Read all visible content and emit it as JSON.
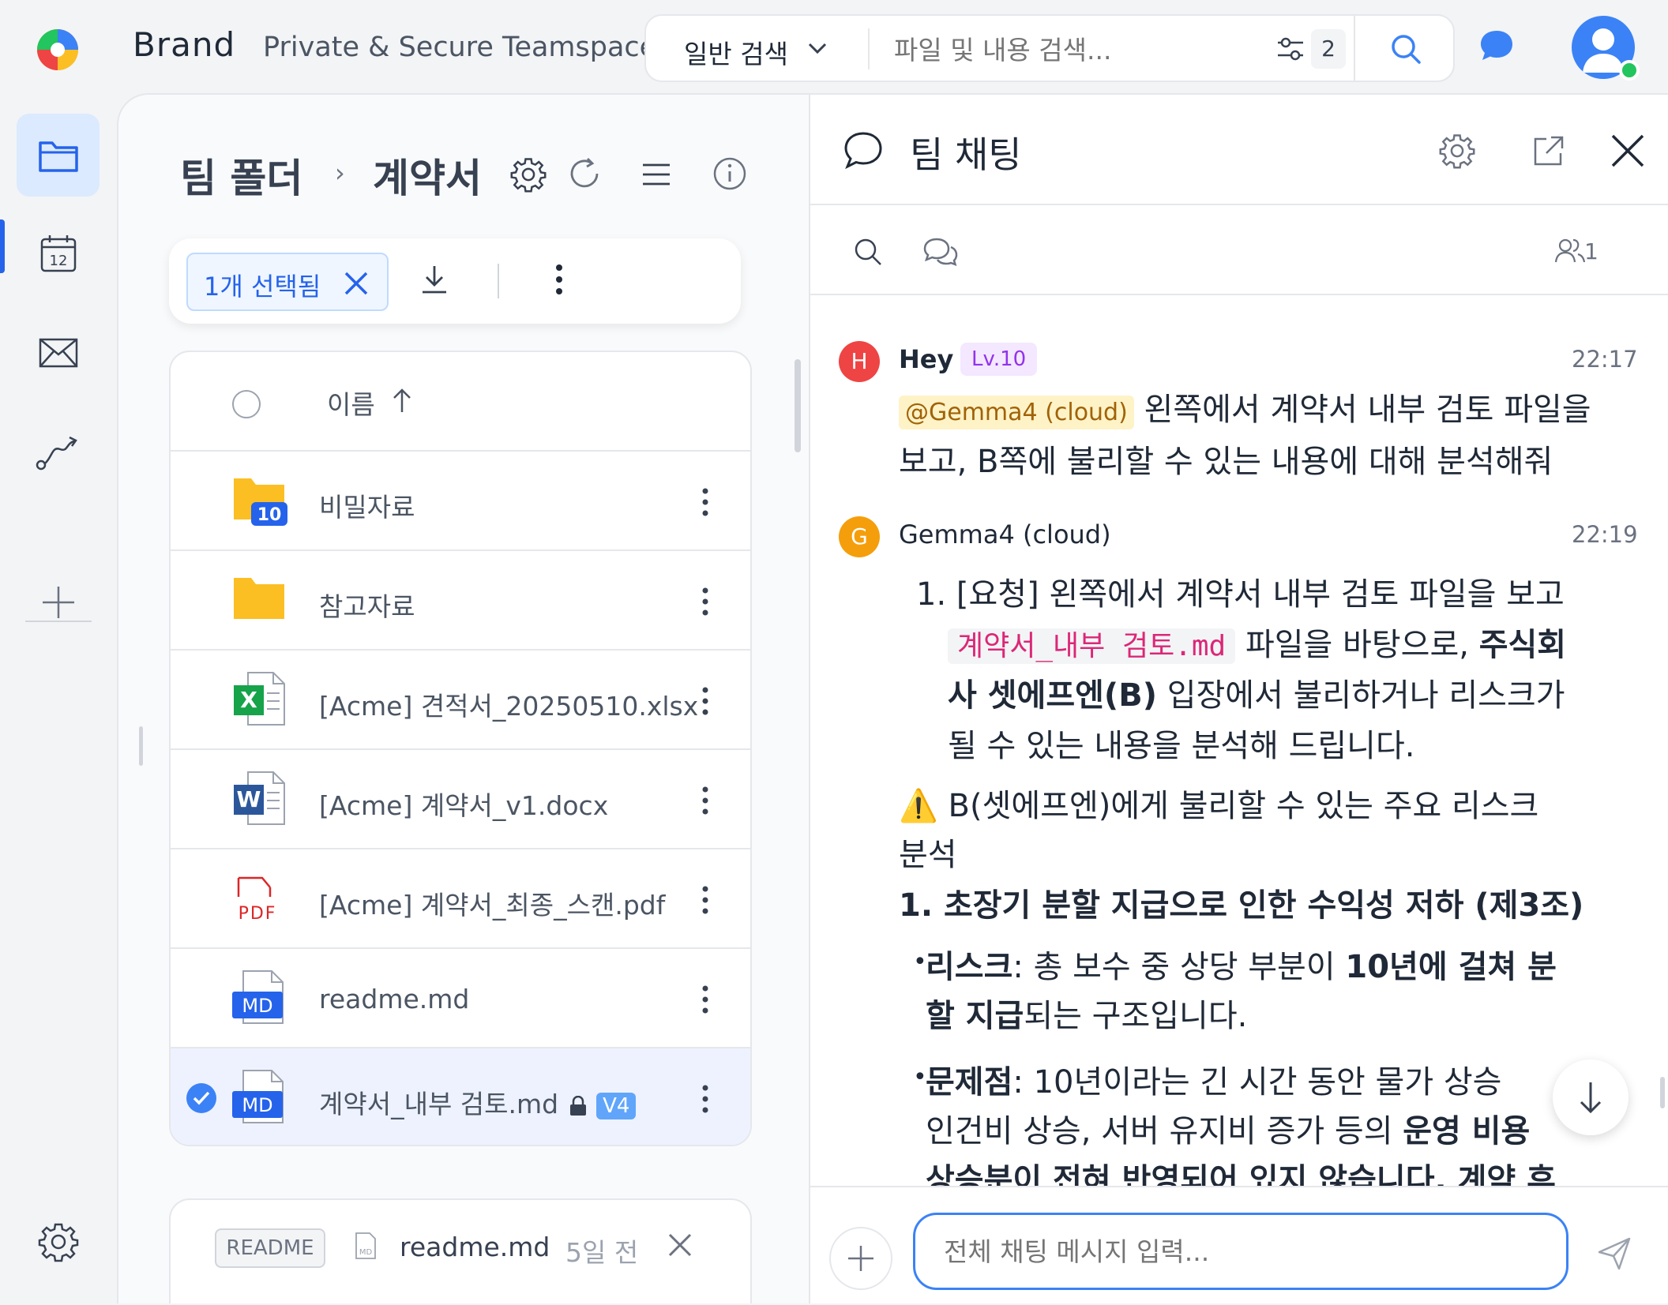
{
  "brand": {
    "name": "Brand",
    "tagline": "Private & Secure Teamspace"
  },
  "search": {
    "scope": "일반 검색",
    "placeholder": "파일 및 내용 검색...",
    "filter_count": "2"
  },
  "sidebar": {
    "items": [
      "folder-icon",
      "calendar-icon",
      "mail-icon",
      "workflow-icon",
      "plus-icon",
      "settings-icon"
    ],
    "calendar_day": "12"
  },
  "folder": {
    "breadcrumb_root": "팀 폴더",
    "breadcrumb_sep": "›",
    "breadcrumb_current": "계약서",
    "selection_label": "1개 선택됨",
    "sort_label": "이름",
    "rows": [
      {
        "name": "비밀자료",
        "type": "folder",
        "badge": "10"
      },
      {
        "name": "참고자료",
        "type": "folder"
      },
      {
        "name": "[Acme] 견적서_20250510.xlsx",
        "type": "xlsx",
        "icon_text": "X"
      },
      {
        "name": "[Acme] 계약서_v1.docx",
        "type": "docx",
        "icon_text": "W"
      },
      {
        "name": "[Acme] 계약서_최종_스캔.pdf",
        "type": "pdf",
        "icon_text": "PDF"
      },
      {
        "name": "readme.md",
        "type": "md",
        "icon_text": "MD"
      },
      {
        "name": "계약서_내부 검토.md",
        "type": "md",
        "icon_text": "MD",
        "version": "V4",
        "selected": true
      }
    ],
    "readme": {
      "badge": "README",
      "filename": "readme.md",
      "time": "5일 전",
      "icon_text": "MD"
    }
  },
  "chat": {
    "title": "팀 채팅",
    "member_count": "1",
    "messages": [
      {
        "initial": "H",
        "user": "Hey",
        "level": "Lv.10",
        "time": "22:17",
        "mention": "@Gemma4 (cloud)",
        "text_1": "왼쪽에서 계약서 내부 검토 파일을",
        "text_2": "보고, B쪽에 불리할 수 있는 내용에 대해 분석해줘"
      },
      {
        "initial": "G",
        "user": "Gemma4 (cloud)",
        "time": "22:19",
        "list_num": "1.",
        "line1": "[요청] 왼쪽에서 계약서 내부 검토 파일을 보고",
        "code": "계약서_내부 검토.md",
        "line2_after": "파일을 바탕으로,",
        "bold1": "주식회",
        "bold2": "사 셋에프엔(B)",
        "line3_after": "입장에서 불리하거나 리스크가",
        "line4": "될 수 있는 내용을 분석해 드립니다.",
        "warn_icon": "⚠️",
        "warn_text_1": "B(셋에프엔)에게 불리할 수 있는 주요 리스크",
        "warn_text_2": "분석",
        "heading": "1. 초장기 분할 지급으로 인한 수익성 저하 (제3조)",
        "bullet1_label": "리스크",
        "bullet1_a": ": 총 보수 중 상당 부분이",
        "bullet1_b": "10년에 걸쳐 분",
        "bullet1_c": "할 지급",
        "bullet1_d": "되는 구조입니다.",
        "bullet2_label": "문제점",
        "bullet2_a": ": 10년이라는 긴 시간 동안 물가 상승",
        "bullet2_b": "인건비 상승, 서버 유지비 증가 등의",
        "bullet2_c": "운영 비용",
        "bullet2_d": "상승분이 전혀 반영되어 있지 않습니다. 계약 후"
      }
    ],
    "input_placeholder": "전체 채팅 메시지 입력..."
  },
  "colors": {
    "accent": "#3b82f6",
    "folder": "#fbbf24",
    "excel": "#16a34a",
    "word": "#2b579a",
    "pdf": "#dc2626",
    "md": "#3b82f6",
    "online": "#22c55e"
  }
}
